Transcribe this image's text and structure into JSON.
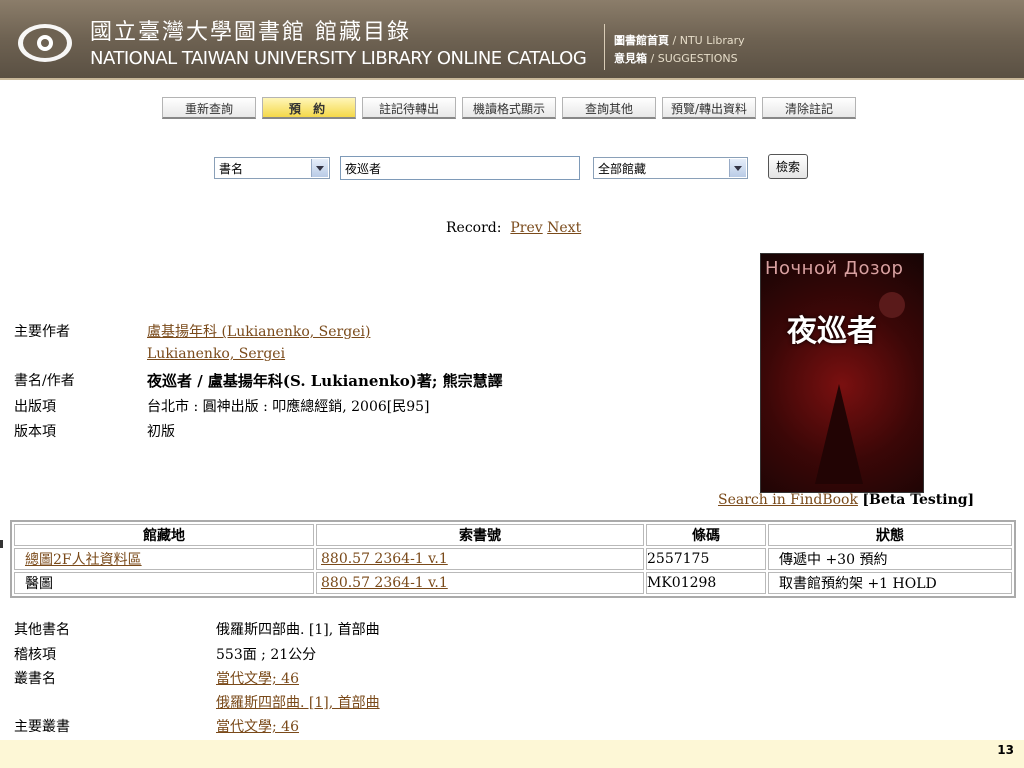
{
  "header": {
    "title_zh": "國立臺灣大學圖書館 館藏目錄",
    "title_en": "NATIONAL TAIWAN UNIVERSITY LIBRARY ONLINE CATALOG",
    "link1_zh": "圖書館首頁",
    "link1_en": "NTU Library",
    "link2_zh": "意見箱",
    "link2_en": "SUGGESTIONS",
    "sep": "/"
  },
  "toolbar": {
    "buttons": [
      "重新查詢",
      "預 約",
      "註記待轉出",
      "機讀格式顯示",
      "查詢其他",
      "預覽/轉出資料",
      "清除註記"
    ]
  },
  "search": {
    "field_type": "書名",
    "query": "夜巡者",
    "scope": "全部館藏",
    "button": "檢索"
  },
  "record_nav": {
    "label": "Record:",
    "prev": "Prev",
    "next": "Next"
  },
  "bib": {
    "author_label": "主要作者",
    "author_link": "盧基揚年科 (Lukianenko, Sergei)",
    "author_alt": "Lukianenko, Sergei",
    "title_label": "書名/作者",
    "title_value": "夜巡者 / 盧基揚年科(S. Lukianenko)著; 熊宗慧譯",
    "pub_label": "出版項",
    "pub_value": "台北市 : 圓神出版 : 叩應總經銷, 2006[民95]",
    "edition_label": "版本項",
    "edition_value": "初版"
  },
  "cover": {
    "ru_title": "Ночной Дозор",
    "zh_title": "夜巡者"
  },
  "findbook": {
    "link": "Search in FindBook",
    "note": "[Beta Testing]"
  },
  "holdings": {
    "headers": [
      "館藏地",
      "索書號",
      "條碼",
      "狀態"
    ],
    "rows": [
      [
        "總圖2F人社資料區",
        "880.57 2364-1 v.1",
        "2557175",
        "傳遞中 +30 預約"
      ],
      [
        "醫圖",
        "880.57 2364-1 v.1",
        "MK01298",
        "取書館預約架 +1 HOLD"
      ]
    ]
  },
  "extra": {
    "other_title_label": "其他書名",
    "other_title_value": "俄羅斯四部曲. [1], 首部曲",
    "collation_label": "稽核項",
    "collation_value": "553面 ; 21公分",
    "series_label": "叢書名",
    "series_value1": "當代文學; 46",
    "series_value2": "俄羅斯四部曲. [1], 首部曲",
    "main_series_label": "主要叢書",
    "main_series_value": "當代文學; 46"
  },
  "page_number": "13",
  "colors": {
    "banner": "#6e6252",
    "link": "#7a4a1a",
    "active_button": "#f4d84a",
    "footer": "#fdf7d6"
  }
}
